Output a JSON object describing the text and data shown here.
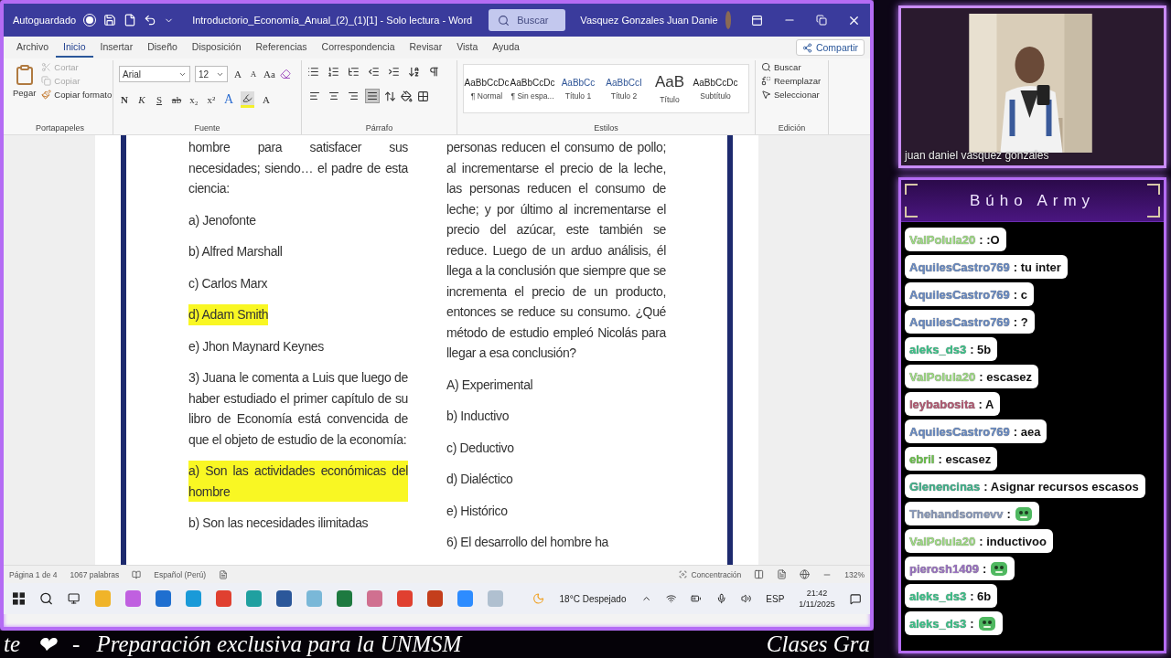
{
  "word": {
    "title_bar": {
      "autosave_label": "Autoguardado",
      "autosave_on": false,
      "title": "Introductorio_Economía_Anual_(2)_(1)[1]  -  Solo lectura  -  Word",
      "search": {
        "placeholder": "Buscar"
      },
      "user": "Vasquez Gonzales Juan Danie"
    },
    "menu_tabs": [
      {
        "label": "Archivo",
        "selected": false
      },
      {
        "label": "Inicio",
        "selected": true
      },
      {
        "label": "Insertar",
        "selected": false
      },
      {
        "label": "Diseño",
        "selected": false
      },
      {
        "label": "Disposición",
        "selected": false
      },
      {
        "label": "Referencias",
        "selected": false
      },
      {
        "label": "Correspondencia",
        "selected": false
      },
      {
        "label": "Revisar",
        "selected": false
      },
      {
        "label": "Vista",
        "selected": false
      },
      {
        "label": "Ayuda",
        "selected": false
      }
    ],
    "share_button": "Compartir",
    "ribbon": {
      "clipboard": {
        "label": "Portapapeles",
        "paste": "Pegar",
        "items": [
          {
            "label": "Cortar",
            "disabled": true
          },
          {
            "label": "Copiar",
            "disabled": true
          },
          {
            "label": "Copiar formato",
            "disabled": false
          }
        ]
      },
      "font": {
        "label": "Fuente",
        "font": "Arial",
        "size": "12",
        "grow": "A",
        "shrink": "A",
        "case": "Aa",
        "format_buttons": [
          "N",
          "K",
          "S",
          "ab",
          "x₂",
          "x²"
        ],
        "text_effect": "A",
        "font_color": "A"
      },
      "paragraph": {
        "label": "Párrafo",
        "alignments": [
          {
            "selected": false
          },
          {
            "selected": false
          },
          {
            "selected": false
          },
          {
            "selected": true
          }
        ]
      },
      "styles": {
        "label": "Estilos",
        "items": [
          {
            "preview": "AaBbCcDc",
            "name": "¶ Normal"
          },
          {
            "preview": "AaBbCcDc",
            "name": "¶ Sin espa..."
          },
          {
            "preview": "AaBbCc",
            "name": "Título 1"
          },
          {
            "preview": "AaBbCcI",
            "name": "Título 2"
          },
          {
            "preview": "AaB",
            "name": "Título"
          },
          {
            "preview": "AaBbCcDc",
            "name": "Subtítulo"
          }
        ]
      },
      "editing": {
        "label": "Edición",
        "items": [
          "Buscar",
          "Reemplazar",
          "Seleccionar"
        ]
      }
    },
    "document": {
      "columns": [
        [
          {
            "text": "hombre para satisfacer sus necesidades; siendo… el padre de esta ciencia:",
            "highlighted": false,
            "kind": "paragraph"
          },
          {
            "text": "a) Jenofonte",
            "highlighted": false,
            "kind": "option"
          },
          {
            "text": "b) Alfred Marshall",
            "highlighted": false,
            "kind": "option"
          },
          {
            "text": "c) Carlos Marx",
            "highlighted": false,
            "kind": "option"
          },
          {
            "text": "d) Adam Smith",
            "highlighted": true,
            "kind": "option"
          },
          {
            "text": "e) Jhon Maynard Keynes",
            "highlighted": false,
            "kind": "option"
          },
          {
            "text": "3) Juana le comenta a Luis que luego de haber estudiado el primer capítulo de su libro de Economía está convencida de que el objeto de estudio de la economía:",
            "highlighted": false,
            "kind": "paragraph"
          },
          {
            "text": "a) Son las actividades económicas del hombre",
            "highlighted": true,
            "kind": "option"
          },
          {
            "text": "b) Son las necesidades ilimitadas",
            "highlighted": false,
            "kind": "option"
          }
        ],
        [
          {
            "text": "personas reducen el consumo de pollo; al incrementarse el precio de la leche, las personas reducen el consumo de leche; y por último al incrementarse el precio del azúcar, este también se reduce. Luego de un arduo análisis, él llega a la conclusión que siempre que se incrementa el precio de un producto, entonces se reduce su consumo. ¿Qué método de estudio empleó Nicolás para llegar a esa conclusión?",
            "highlighted": false,
            "kind": "paragraph"
          },
          {
            "text": "A) Experimental",
            "highlighted": false,
            "kind": "option"
          },
          {
            "text": "b) Inductivo",
            "highlighted": false,
            "kind": "option"
          },
          {
            "text": "c) Deductivo",
            "highlighted": false,
            "kind": "option"
          },
          {
            "text": "d) Dialéctico",
            "highlighted": false,
            "kind": "option"
          },
          {
            "text": "e) Histórico",
            "highlighted": false,
            "kind": "option"
          },
          {
            "text": "6) El desarrollo del hombre ha",
            "highlighted": false,
            "kind": "option"
          }
        ]
      ]
    },
    "status_bar": {
      "page": "Página 1 de 4",
      "words": "1067 palabras",
      "language": "Español (Perú)",
      "focus": "Concentración",
      "zoom": "132%"
    },
    "taskbar": {
      "weather": "18°C  Despejado",
      "language": "ESP",
      "time": "21:42",
      "date": "1/11/2025"
    }
  },
  "ticker": {
    "left": "te",
    "heart": "❤",
    "separator": "-",
    "text": "Preparación exclusiva para la UNMSM",
    "right": "Clases Gra"
  },
  "webcam": {
    "caption": "juan daniel vasquez gonzales"
  },
  "chat": {
    "title": "Búho Army",
    "messages": [
      {
        "user": "ValPolula20",
        "color": "#9fdc84",
        "kind": "text",
        "text": ": :O"
      },
      {
        "user": "AquilesCastro769",
        "color": "#6a8cc4",
        "kind": "text",
        "text": ": tu inter"
      },
      {
        "user": "AquilesCastro769",
        "color": "#6a8cc4",
        "kind": "text",
        "text": ": c"
      },
      {
        "user": "AquilesCastro769",
        "color": "#6a8cc4",
        "kind": "text",
        "text": ": ?"
      },
      {
        "user": "aleks_ds3",
        "color": "#3cc48a",
        "kind": "text",
        "text": ": 5b"
      },
      {
        "user": "ValPolula20",
        "color": "#9fdc84",
        "kind": "text",
        "text": ": escasez"
      },
      {
        "user": "leybabosita",
        "color": "#b45c74",
        "kind": "text",
        "text": ": A"
      },
      {
        "user": "AquilesCastro769",
        "color": "#6a8cc4",
        "kind": "text",
        "text": ": aea"
      },
      {
        "user": "ebril",
        "color": "#6cc44c",
        "kind": "text",
        "text": ": escasez"
      },
      {
        "user": "Glenencinas",
        "color": "#40b48c",
        "kind": "text",
        "text": ": Asignar recursos escasos"
      },
      {
        "user": "Thehandsomevv",
        "color": "#8c9cbc",
        "kind": "emote",
        "text": ":"
      },
      {
        "user": "ValPolula20",
        "color": "#9fdc84",
        "kind": "text",
        "text": ": inductivoo"
      },
      {
        "user": "pierosh1409",
        "color": "#9c74c4",
        "kind": "emote",
        "text": ":"
      },
      {
        "user": "aleks_ds3",
        "color": "#3cc48a",
        "kind": "text",
        "text": ": 6b"
      },
      {
        "user": "aleks_ds3",
        "color": "#3cc48a",
        "kind": "emote",
        "text": ":"
      }
    ]
  }
}
